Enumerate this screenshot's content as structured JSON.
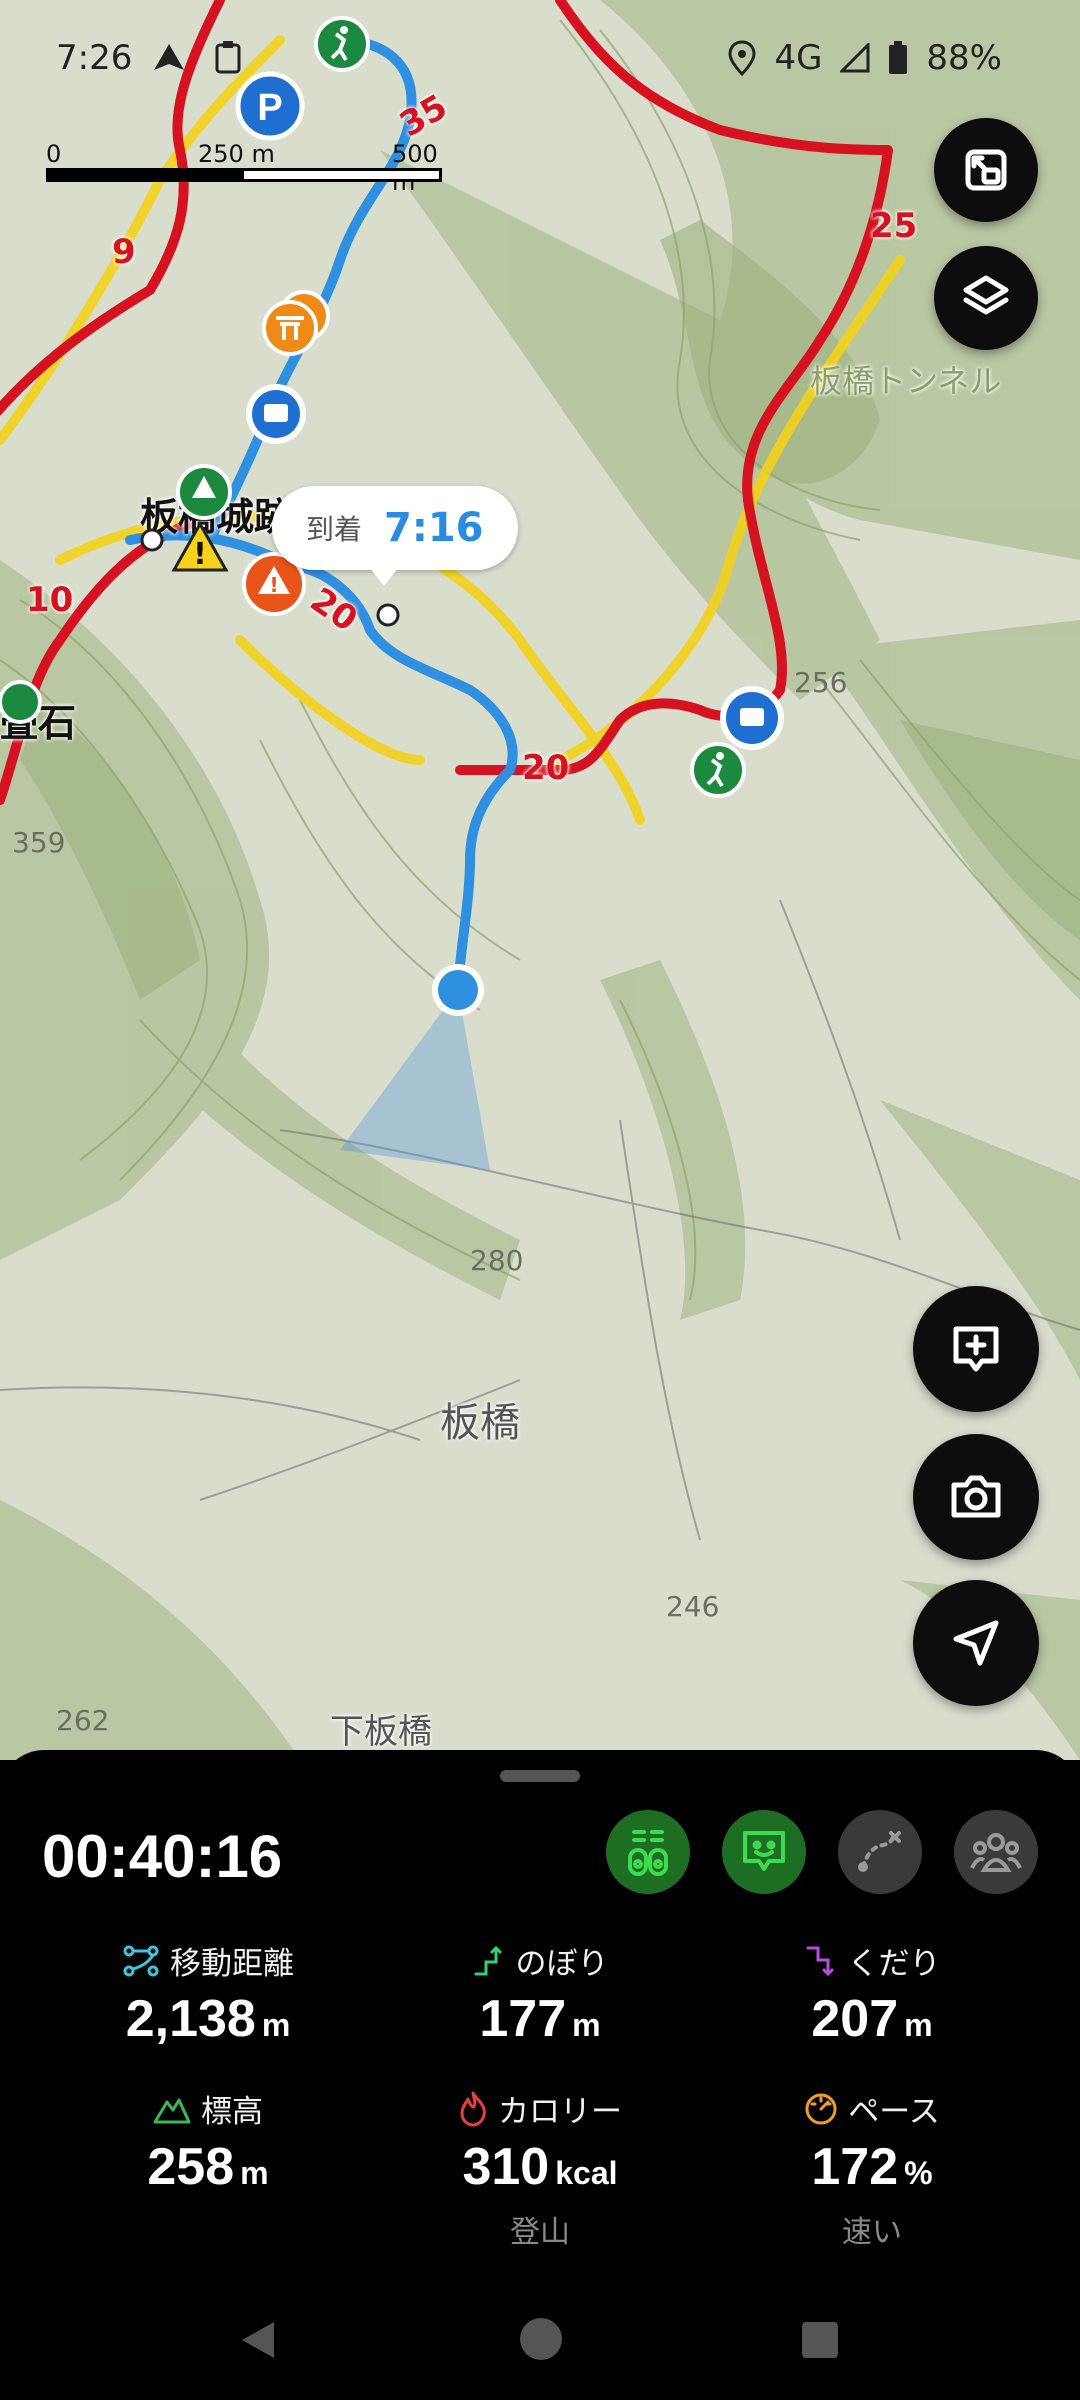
{
  "status_bar": {
    "time": "7:26",
    "network": "4G",
    "battery": "88%"
  },
  "scale": {
    "zero": "0",
    "mid": "250 m",
    "end": "500 m"
  },
  "map": {
    "place_labels": [
      "板橋城跡",
      "畳石",
      "板橋",
      "下板橋",
      "板橋トンネル"
    ],
    "route_numbers": [
      "35",
      "25",
      "9",
      "10",
      "20",
      "20"
    ],
    "elevations": [
      "256",
      "359",
      "280",
      "246",
      "262"
    ],
    "arrival_label": "到着",
    "arrival_time": "7:16"
  },
  "activity": {
    "elapsed": "00:40:16",
    "stats": [
      {
        "label": "移動距離",
        "value": "2,138",
        "unit": "m",
        "sub": ""
      },
      {
        "label": "のぼり",
        "value": "177",
        "unit": "m",
        "sub": ""
      },
      {
        "label": "くだり",
        "value": "207",
        "unit": "m",
        "sub": ""
      },
      {
        "label": "標高",
        "value": "258",
        "unit": "m",
        "sub": ""
      },
      {
        "label": "カロリー",
        "value": "310",
        "unit": "kcal",
        "sub": "登山"
      },
      {
        "label": "ペース",
        "value": "172",
        "unit": "%",
        "sub": "速い"
      }
    ]
  },
  "colors": {
    "route_red": "#d61220",
    "track_blue": "#2f8fe0",
    "active_green": "#1d6e22",
    "sheet_bg": "#000000"
  }
}
